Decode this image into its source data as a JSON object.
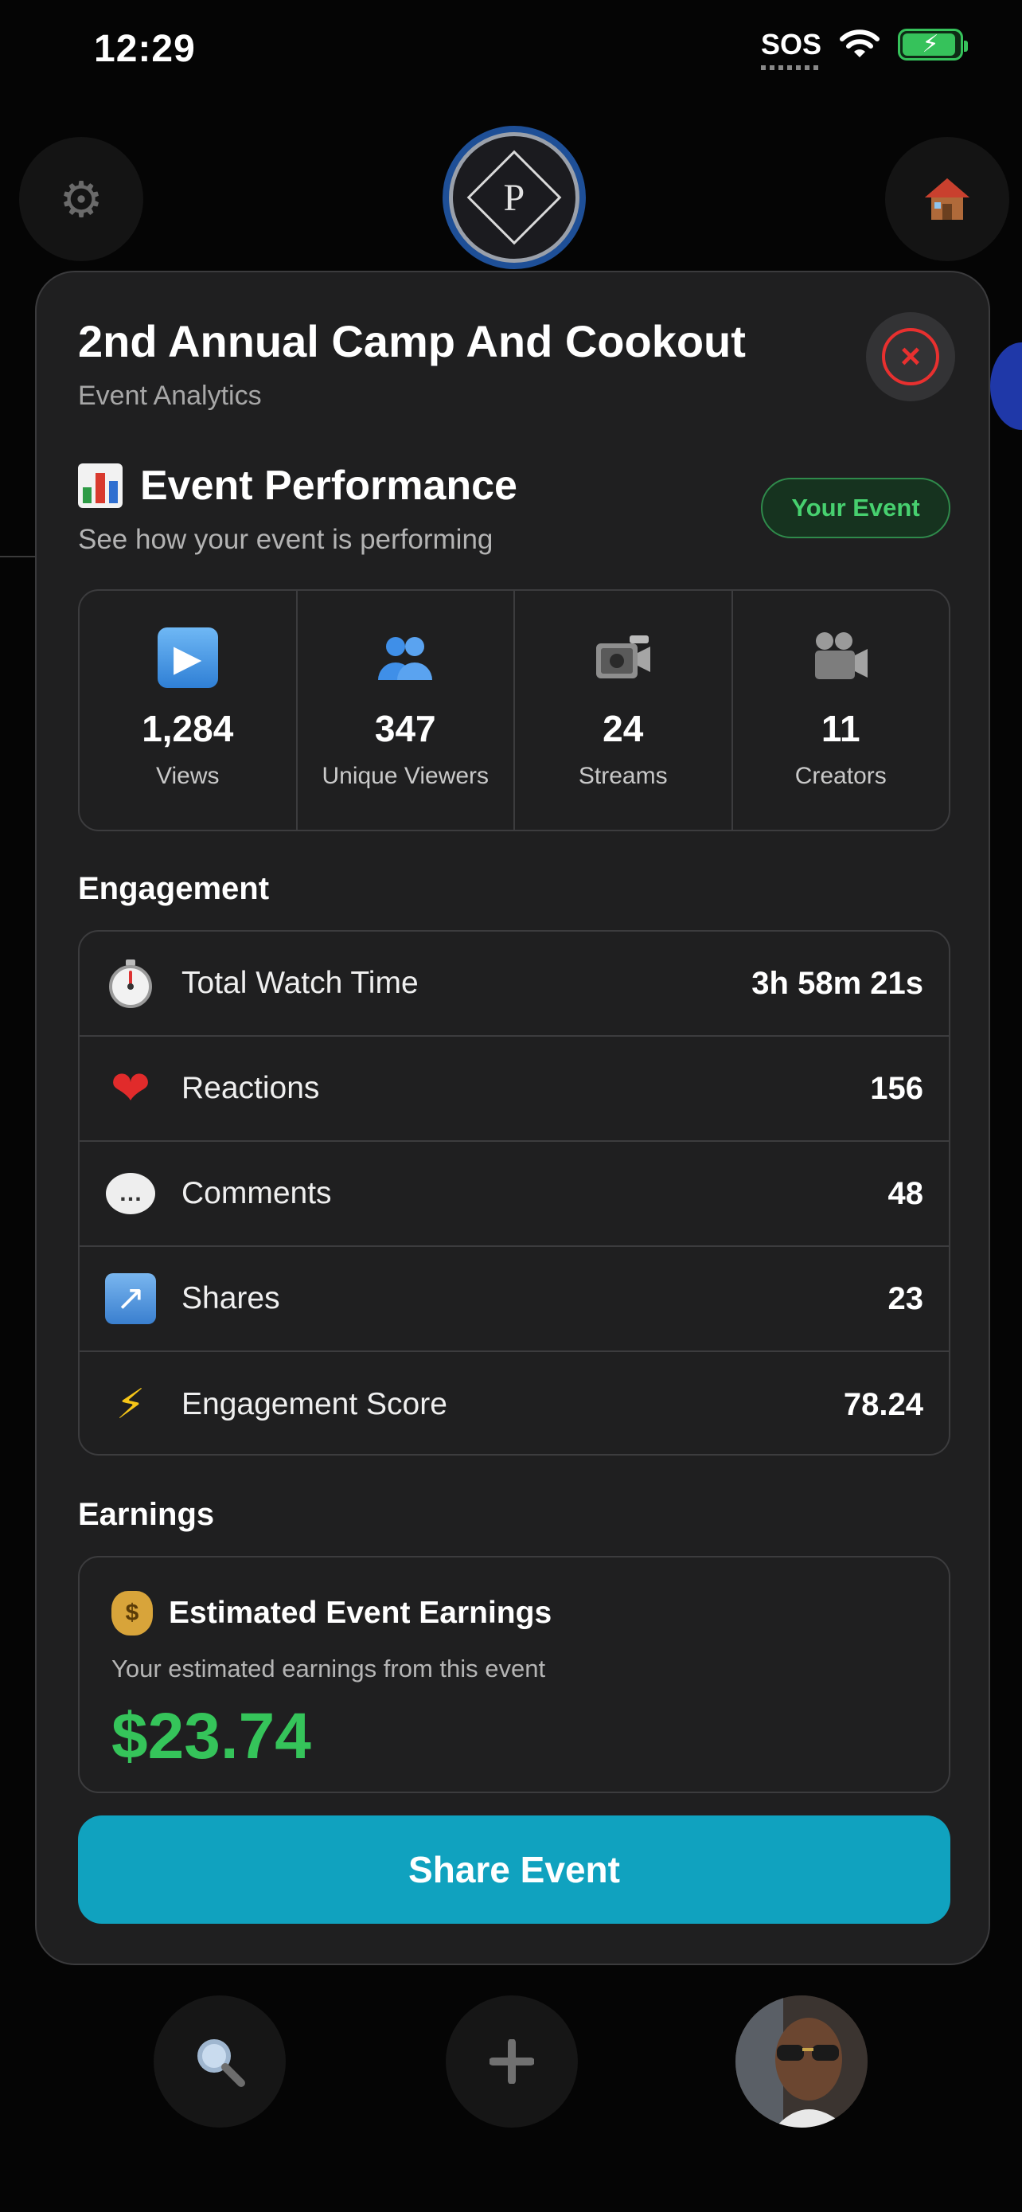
{
  "status_bar": {
    "time": "12:29",
    "sos": "SOS",
    "battery_level": 0.9
  },
  "header": {
    "logo_letter": "P"
  },
  "modal": {
    "title": "2nd Annual Camp And Cookout",
    "subtitle": "Event Analytics",
    "close_icon": "close-circle-icon"
  },
  "performance": {
    "title": "Event Performance",
    "subtitle": "See how your event is performing",
    "badge": "Your Event",
    "stats": [
      {
        "icon": "play-icon",
        "value": "1,284",
        "label": "Views"
      },
      {
        "icon": "users-icon",
        "value": "347",
        "label": "Unique Viewers"
      },
      {
        "icon": "video-camera-icon",
        "value": "24",
        "label": "Streams"
      },
      {
        "icon": "movie-camera-icon",
        "value": "11",
        "label": "Creators"
      }
    ]
  },
  "engagement": {
    "title": "Engagement",
    "rows": [
      {
        "icon": "stopwatch-icon",
        "label": "Total Watch Time",
        "value": "3h 58m 21s"
      },
      {
        "icon": "heart-icon",
        "label": "Reactions",
        "value": "156"
      },
      {
        "icon": "speech-bubble-icon",
        "label": "Comments",
        "value": "48"
      },
      {
        "icon": "share-arrow-icon",
        "label": "Shares",
        "value": "23"
      },
      {
        "icon": "lightning-icon",
        "label": "Engagement Score",
        "value": "78.24"
      }
    ]
  },
  "earnings": {
    "title": "Earnings",
    "card_title": "Estimated Event Earnings",
    "card_subtitle": "Your estimated earnings from this event",
    "amount": "$23.74"
  },
  "share_button": "Share Event",
  "colors": {
    "accent": "#10a2bf",
    "success": "#35c45a",
    "danger": "#e8302f"
  }
}
